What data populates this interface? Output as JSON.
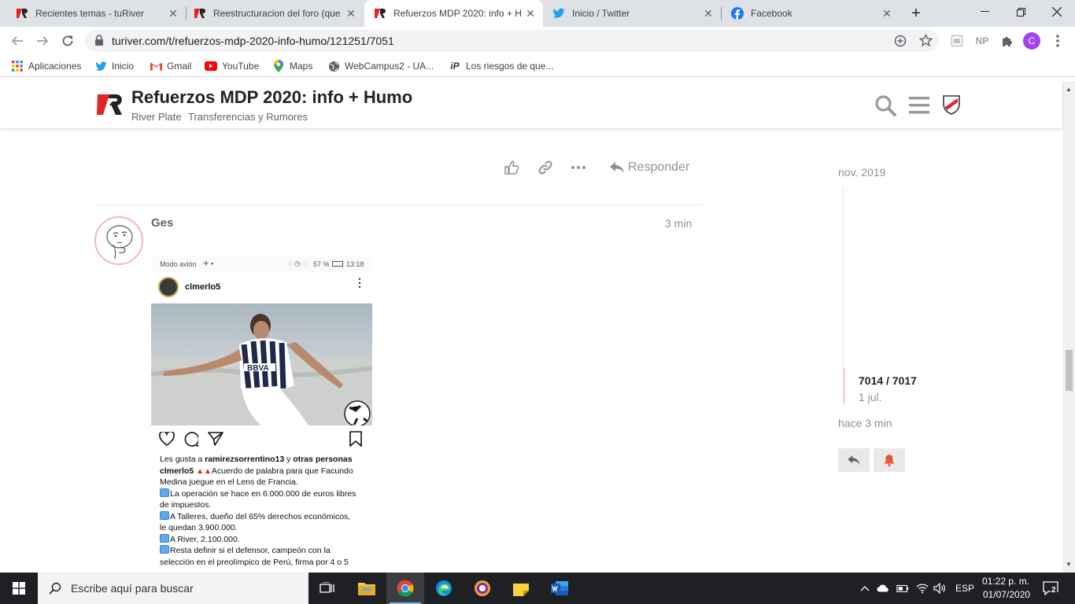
{
  "browser": {
    "tabs": [
      {
        "label": "Recientes temas - tuRiver"
      },
      {
        "label": "Reestructuracion del foro (que"
      },
      {
        "label": "Refuerzos MDP 2020: info + H"
      },
      {
        "label": "Inicio / Twitter"
      },
      {
        "label": "Facebook"
      }
    ],
    "url": "turiver.com/t/refuerzos-mdp-2020-info-humo/121251/7051",
    "extension_np": "NP",
    "profile_initial": "C",
    "bookmarks": [
      {
        "label": "Aplicaciones"
      },
      {
        "label": "Inicio"
      },
      {
        "label": "Gmail"
      },
      {
        "label": "YouTube"
      },
      {
        "label": "Maps"
      },
      {
        "label": "WebCampus2 - UA..."
      },
      {
        "label": "Los riesgos de que..."
      }
    ]
  },
  "header": {
    "title": "Refuerzos MDP 2020: info + Humo",
    "breadcrumbs": [
      "River Plate",
      "Transferencias y Rumores"
    ]
  },
  "post_actions": {
    "reply_label": "Responder"
  },
  "post": {
    "username": "Ges",
    "time": "3 min"
  },
  "instagram": {
    "status_left": "Modo avión",
    "status_right": "57 %",
    "status_time": "13:18",
    "username": "clmerlo5",
    "likes_prefix": "Les gusta a",
    "likes_user": "ramirezsorrentino13",
    "likes_and": "y",
    "likes_others": "otras personas",
    "caption_user": "clmerlo5",
    "lines": [
      "Acuerdo de palabra para que Facundo",
      "Medina juegue en el Lens de Francia.",
      "La operación se hace en 6.000.000 de euros libres",
      "de impuestos.",
      "A Talleres, dueño del 65% derechos económicos,",
      "le quedan 3.900.000.",
      "A River, 2.100.000.",
      "Resta definir si el defensor, campeón con la",
      "selección en el preolímpico de Perú, firma por 4 o 5"
    ]
  },
  "timeline": {
    "start_date": "nov. 2019",
    "position": "7014 / 7017",
    "position_date": "1 jul.",
    "end_label": "hace 3 min"
  },
  "taskbar": {
    "search_placeholder": "Escribe aquí para buscar",
    "language": "ESP",
    "time": "01:22 p. m.",
    "date": "01/07/2020",
    "notifications": "2"
  },
  "colors": {
    "brand_red": "#e52321",
    "brand_dark": "#222222",
    "notif_red": "#e45735"
  }
}
